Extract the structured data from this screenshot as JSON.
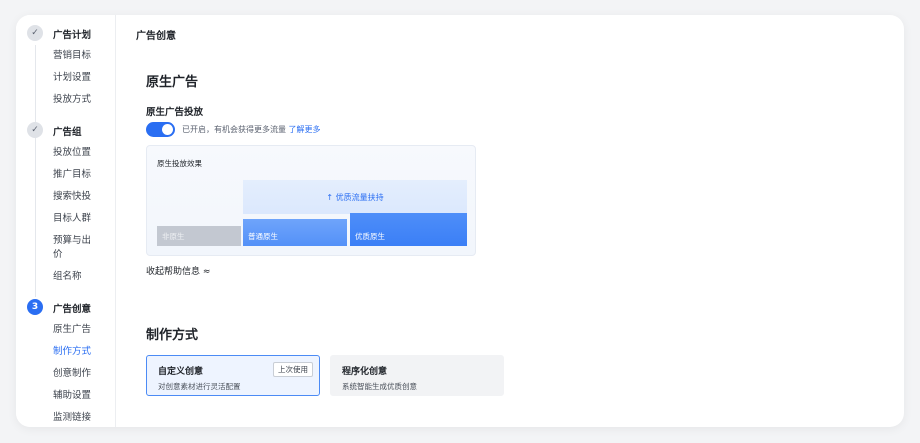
{
  "sidebar": {
    "steps": [
      {
        "title": "广告计划",
        "marker": "✓",
        "items": [
          "营销目标",
          "计划设置",
          "投放方式"
        ]
      },
      {
        "title": "广告组",
        "marker": "✓",
        "items": [
          "投放位置",
          "推广目标",
          "搜索快投",
          "目标人群",
          "预算与出价",
          "组名称"
        ]
      },
      {
        "title": "广告创意",
        "marker": "3",
        "items": [
          "原生广告",
          "制作方式",
          "创意制作",
          "辅助设置",
          "监测链接"
        ]
      }
    ],
    "current_item": "制作方式"
  },
  "main": {
    "page_title": "广告创意",
    "native_section": {
      "title": "原生广告",
      "field_label": "原生广告投放",
      "toggle_on": true,
      "toggle_text": "已开启，有机会获得更多流量",
      "learn_more": "了解更多",
      "effect": {
        "title": "原生投放效果",
        "support_label": "↑ 优质流量扶持",
        "bars": [
          {
            "label": "非原生",
            "level": "low"
          },
          {
            "label": "普通原生",
            "level": "medium"
          },
          {
            "label": "优质原生",
            "level": "high"
          }
        ]
      },
      "collapse_label": "收起帮助信息 ≈"
    },
    "production_section": {
      "title": "制作方式",
      "options": [
        {
          "title": "自定义创意",
          "desc": "对创意素材进行灵活配置",
          "badge": "上次使用",
          "selected": true
        },
        {
          "title": "程序化创意",
          "desc": "系统智能生成优质创意",
          "selected": false
        }
      ]
    }
  },
  "colors": {
    "accent": "#2a6ef2",
    "selected_border": "#4c8bf5",
    "sidebar_divider": "#eceef1"
  }
}
